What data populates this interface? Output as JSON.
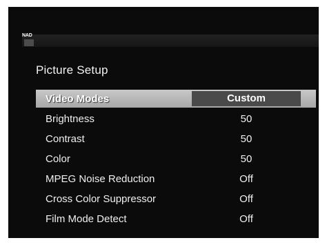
{
  "brand": {
    "logo_text": "NAD"
  },
  "page": {
    "title": "Picture Setup"
  },
  "menu": {
    "items": [
      {
        "label": "Video Modes",
        "value": "Custom",
        "selected": true
      },
      {
        "label": "Brightness",
        "value": "50"
      },
      {
        "label": "Contrast",
        "value": "50"
      },
      {
        "label": "Color",
        "value": "50"
      },
      {
        "label": "MPEG Noise Reduction",
        "value": "Off"
      },
      {
        "label": "Cross Color Suppressor",
        "value": "Off"
      },
      {
        "label": "Film Mode Detect",
        "value": "Off"
      }
    ]
  },
  "colors": {
    "background": "#0b0b0b",
    "highlight": "#b8b8b8",
    "value_box": "#4a4a4a",
    "text": "#efefef"
  }
}
